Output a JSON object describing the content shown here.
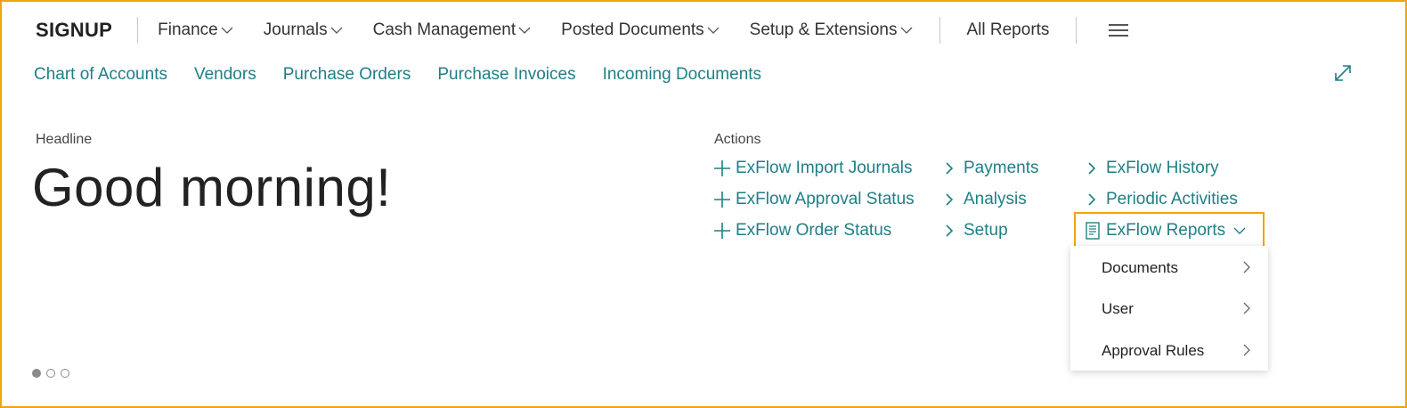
{
  "brand": "SIGNUP",
  "nav": {
    "menus": [
      "Finance",
      "Journals",
      "Cash Management",
      "Posted Documents",
      "Setup & Extensions"
    ],
    "all_reports": "All Reports"
  },
  "subnav": [
    "Chart of Accounts",
    "Vendors",
    "Purchase Orders",
    "Purchase Invoices",
    "Incoming Documents"
  ],
  "headline": {
    "label": "Headline",
    "greeting": "Good morning!"
  },
  "actions": {
    "label": "Actions",
    "col1": [
      "ExFlow Import Journals",
      "ExFlow Approval Status",
      "ExFlow Order Status"
    ],
    "col2": [
      "Payments",
      "Analysis",
      "Setup"
    ],
    "col3": [
      "ExFlow History",
      "Periodic Activities",
      "ExFlow Reports"
    ]
  },
  "reports_menu": [
    "Documents",
    "User",
    "Approval Rules"
  ],
  "colors": {
    "accent": "#1e7f86",
    "highlight": "#f0a30a"
  }
}
